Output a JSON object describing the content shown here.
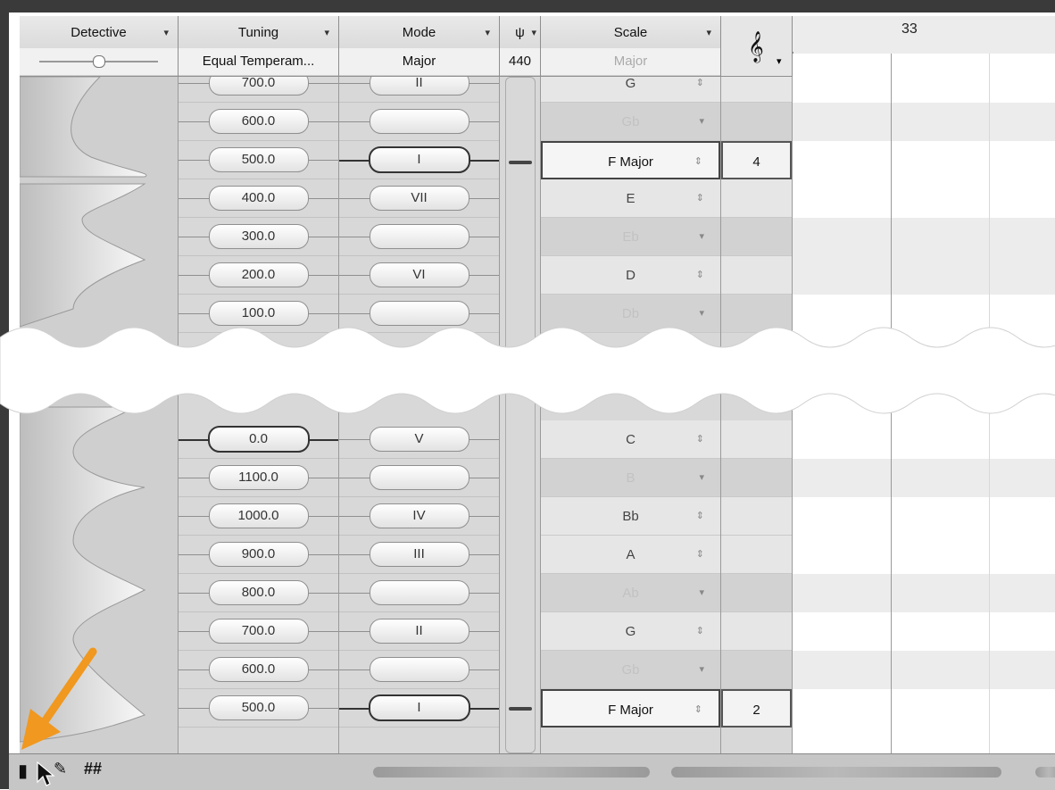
{
  "header": {
    "detective": {
      "title": "Detective"
    },
    "tuning": {
      "title": "Tuning",
      "value": "Equal Temperam..."
    },
    "mode": {
      "title": "Mode",
      "value": "Major"
    },
    "ref": {
      "icon": "tuning-fork-icon",
      "value": "440"
    },
    "scale": {
      "title": "Scale",
      "value": "Major"
    },
    "clef": {
      "icon": "treble-clef-icon"
    }
  },
  "ruler": {
    "bar": "33"
  },
  "upper": {
    "tuning": [
      "700.0",
      "600.0",
      "500.0",
      "400.0",
      "300.0",
      "200.0",
      "100.0"
    ],
    "mode": [
      "II",
      "",
      "I",
      "VII",
      "",
      "VI",
      ""
    ],
    "scale": [
      "G",
      "Gb",
      "F Major",
      "E",
      "Eb",
      "D",
      "Db"
    ],
    "octave": [
      "",
      "",
      "4",
      "",
      "",
      "",
      ""
    ]
  },
  "lower": {
    "tuning": [
      "0.0",
      "1100.0",
      "1000.0",
      "900.0",
      "800.0",
      "700.0",
      "600.0",
      "500.0"
    ],
    "mode": [
      "V",
      "",
      "IV",
      "III",
      "",
      "II",
      "",
      "I"
    ],
    "scale": [
      "C",
      "B",
      "Bb",
      "A",
      "Ab",
      "G",
      "Gb",
      "F Major"
    ],
    "octave": [
      "",
      "",
      "",
      "",
      "",
      "",
      "",
      "2"
    ]
  },
  "toolbar": {
    "tools": [
      "pointer-tool-icon",
      "wrench-tool-icon",
      "sharp-accidentals-icon"
    ],
    "sharp_glyph": "##"
  },
  "colors": {
    "accent_arrow": "#f0981f",
    "selection_border": "#333333"
  }
}
